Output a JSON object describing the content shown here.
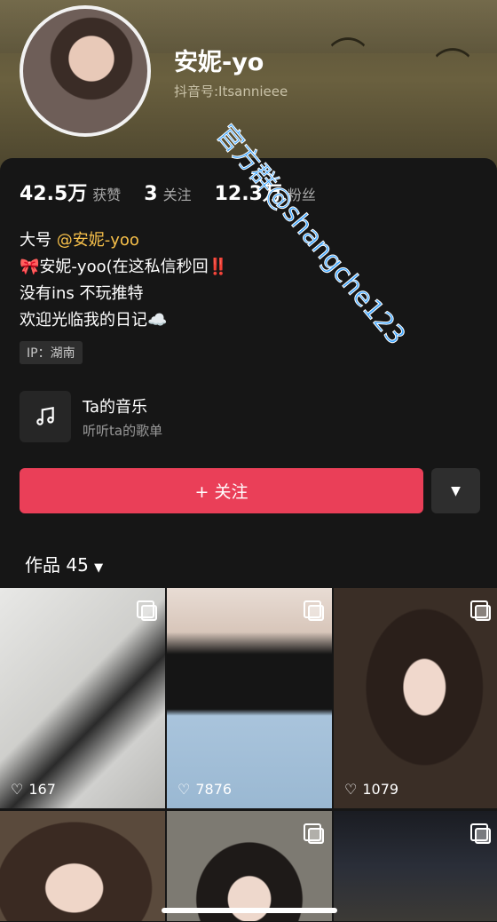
{
  "profile": {
    "name": "安妮-yo",
    "douyin_id": "抖音号:Itsannieee",
    "watermark": "官方群@shangche123"
  },
  "stats": [
    {
      "value": "42.5万",
      "label": "获赞"
    },
    {
      "value": "3",
      "label": "关注"
    },
    {
      "value": "12.3万",
      "label": "粉丝"
    }
  ],
  "bio": {
    "line1_prefix": "大号 ",
    "line1_mention": "@安妮-yoo",
    "line2": "安妮-yoo(在这私信秒回",
    "line2_emoji": "‼️",
    "line3": "没有ins 不玩推特",
    "line4": "欢迎光临我的日记",
    "line4_emoji": "☁️"
  },
  "ip": "IP：湖南",
  "music": {
    "title": "Ta的音乐",
    "subtitle": "听听ta的歌单",
    "icon": "music-note-icon"
  },
  "actions": {
    "follow_label": "+ 关注",
    "dropdown_icon": "caret-down-icon"
  },
  "works": {
    "tab_label": "作品 45"
  },
  "videos": [
    {
      "likes": "167"
    },
    {
      "likes": "7876"
    },
    {
      "likes": "1079"
    }
  ],
  "colors": {
    "follow_button": "#ea3f58",
    "mention": "#f7c04a",
    "watermark": "#3ea6ff",
    "background": "#161616"
  }
}
